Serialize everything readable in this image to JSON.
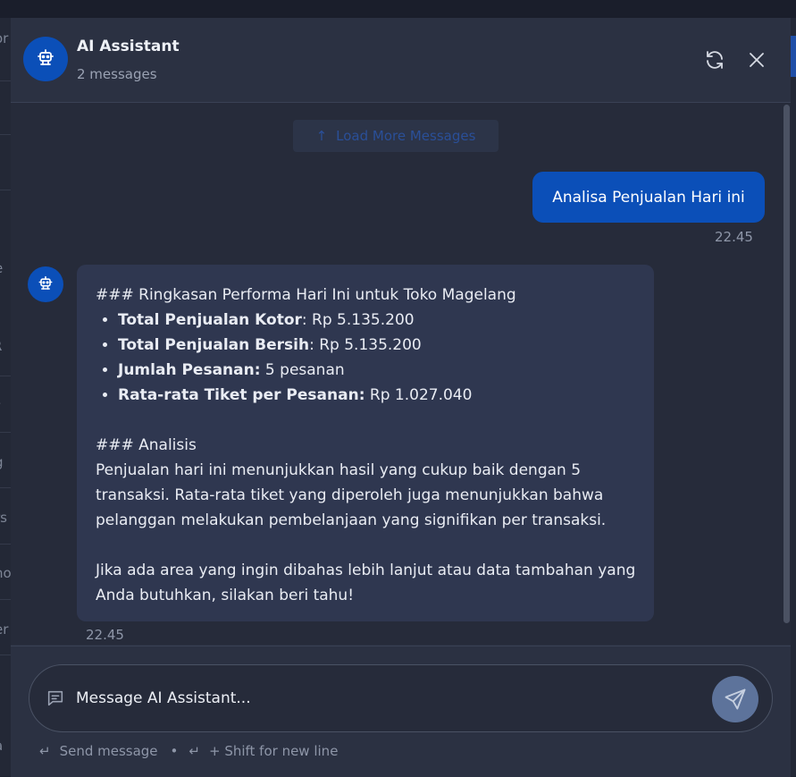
{
  "background": {
    "left_fragments": [
      "or",
      "e",
      "R",
      "r",
      "g",
      "rs",
      "no",
      "er",
      "a"
    ]
  },
  "header": {
    "title": "AI Assistant",
    "subtitle": "2 messages"
  },
  "messages": {
    "load_more_label": "Load More Messages",
    "user": {
      "text": "Analisa Penjualan Hari ini",
      "time": "22.45"
    },
    "assistant": {
      "heading1": "### Ringkasan Performa Hari Ini untuk Toko Magelang",
      "bullets": [
        {
          "label": "Total Penjualan Kotor",
          "value": ": Rp 5.135.200"
        },
        {
          "label": "Total Penjualan Bersih",
          "value": ": Rp 5.135.200"
        },
        {
          "label": "Jumlah Pesanan:",
          "value": " 5 pesanan"
        },
        {
          "label": "Rata-rata Tiket per Pesanan:",
          "value": " Rp 1.027.040"
        }
      ],
      "heading2": "### Analisis",
      "paragraph1": "Penjualan hari ini menunjukkan hasil yang cukup baik dengan 5 transaksi. Rata-rata tiket yang diperoleh juga menunjukkan bahwa pelanggan melakukan pembelanjaan yang signifikan per transaksi.",
      "paragraph2": "Jika ada area yang ingin dibahas lebih lanjut atau data tambahan yang Anda butuhkan, silakan beri tahu!",
      "time": "22.45"
    }
  },
  "composer": {
    "placeholder": "Message AI Assistant...",
    "hint_send": "Send message",
    "hint_dot": "•",
    "hint_newline": "+ Shift for new line"
  },
  "colors": {
    "accent": "#0b4fb8",
    "panel": "#2b3142",
    "bubble": "#2f3750"
  },
  "icons": {
    "avatar": "robot-icon",
    "refresh": "refresh-icon",
    "close": "close-icon",
    "load_more": "arrow-up-icon",
    "message": "message-icon",
    "send": "send-icon",
    "enter": "enter-key-icon"
  }
}
